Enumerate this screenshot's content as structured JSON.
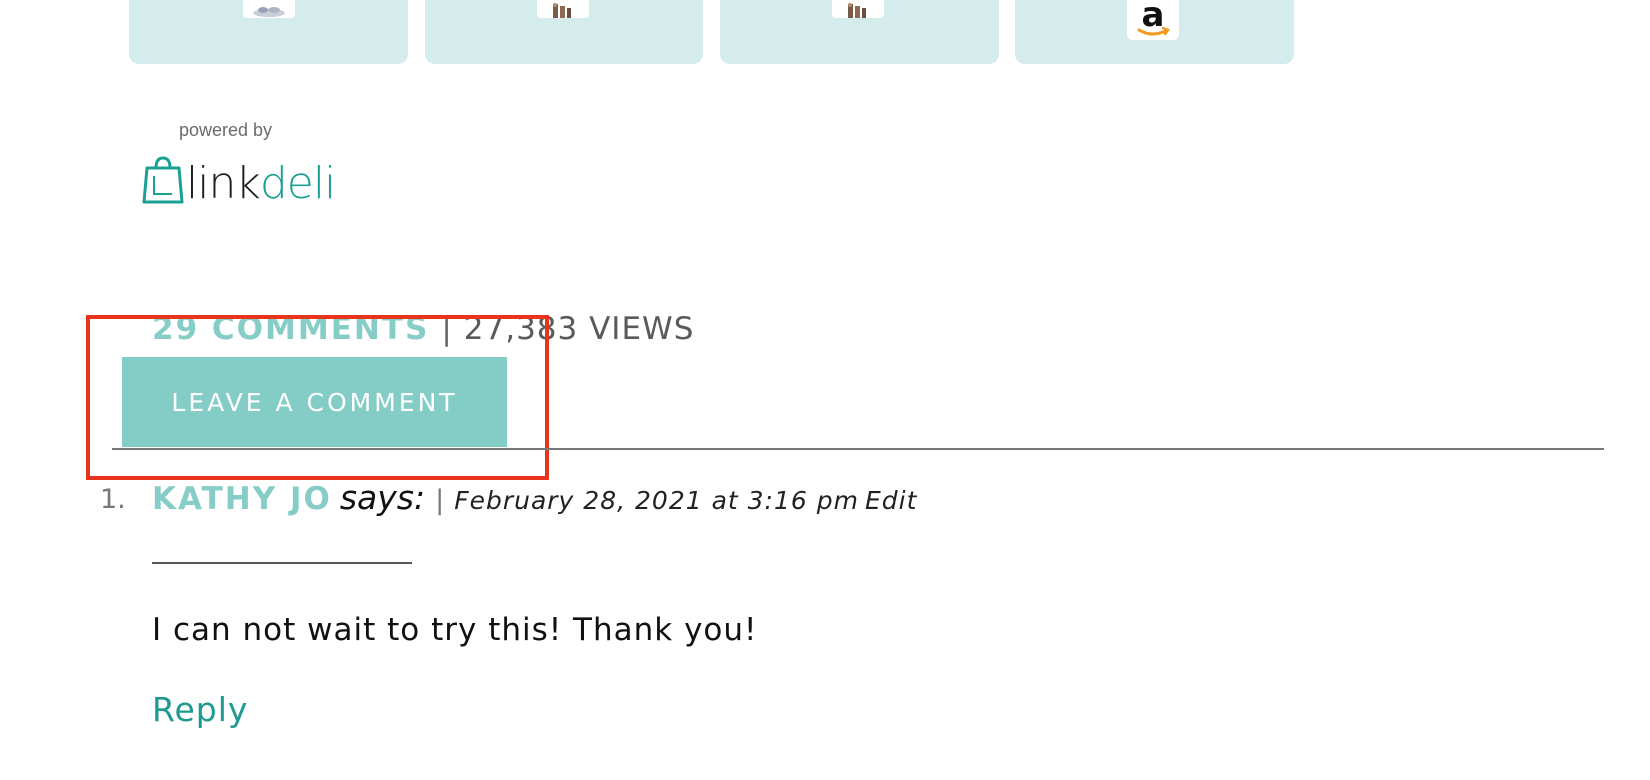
{
  "products": {
    "cards": [
      {
        "thumb_icon": "product-thumbnail-icon"
      },
      {
        "thumb_icon": "product-thumbnail-icon"
      },
      {
        "thumb_icon": "product-thumbnail-icon"
      },
      {
        "thumb_icon": "amazon-logo-icon"
      }
    ]
  },
  "attribution": {
    "powered_by": "powered by",
    "brand_part1": "link",
    "brand_part2": "deli",
    "icon": "shopping-bag-icon"
  },
  "comments_meta": {
    "count_label": "29 COMMENTS",
    "separator": "|",
    "views_label": "27,383 VIEWS",
    "leave_comment_label": "LEAVE A COMMENT"
  },
  "comments": [
    {
      "number": "1.",
      "author": "KATHY JO",
      "says": "says:",
      "separator": "|",
      "date": "February 28, 2021 at 3:16 pm",
      "edit_label": "Edit",
      "text": "I can not wait to try this! Thank you!",
      "reply_label": "Reply"
    }
  ],
  "colors": {
    "accent": "#85cdc6",
    "card_bg": "#d4edec",
    "reply": "#1e9a90",
    "brand_green": "#1ba094",
    "highlight": "#e8341c"
  }
}
